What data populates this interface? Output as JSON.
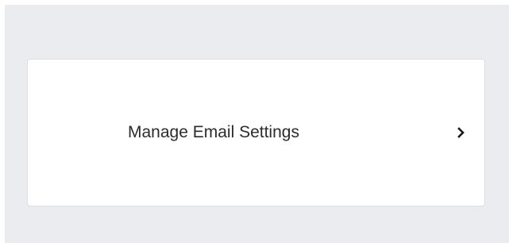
{
  "settings_card": {
    "label": "Manage Email Settings",
    "chevron_icon": "chevron-right-icon"
  },
  "colors": {
    "page_background": "#ebecf0",
    "card_background": "#ffffff",
    "text": "#2b2b2b",
    "icon": "#1a1a1a"
  }
}
